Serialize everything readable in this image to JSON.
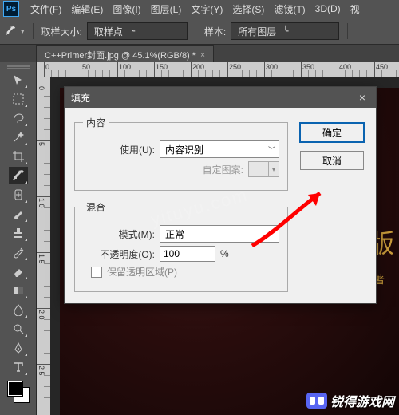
{
  "app_icon_text": "Ps",
  "menubar": [
    "文件(F)",
    "编辑(E)",
    "图像(I)",
    "图层(L)",
    "文字(Y)",
    "选择(S)",
    "滤镜(T)",
    "3D(D)",
    "视"
  ],
  "options_bar": {
    "sample_size_label": "取样大小:",
    "sample_size_value": "取样点",
    "sample_label": "样本:",
    "sample_value": "所有图层"
  },
  "doc_tab": {
    "label": "C++Primer封面.jpg @ 45.1%(RGB/8) *",
    "close": "×"
  },
  "tools": [
    {
      "name": "move-tool-icon"
    },
    {
      "name": "marquee-tool-icon"
    },
    {
      "name": "lasso-tool-icon"
    },
    {
      "name": "magic-wand-tool-icon"
    },
    {
      "name": "crop-tool-icon"
    },
    {
      "name": "eyedropper-tool-icon",
      "selected": true
    },
    {
      "name": "healing-brush-tool-icon"
    },
    {
      "name": "brush-tool-icon"
    },
    {
      "name": "stamp-tool-icon"
    },
    {
      "name": "history-brush-tool-icon"
    },
    {
      "name": "eraser-tool-icon"
    },
    {
      "name": "gradient-tool-icon"
    },
    {
      "name": "blur-tool-icon"
    },
    {
      "name": "dodge-tool-icon"
    },
    {
      "name": "pen-tool-icon"
    },
    {
      "name": "type-tool-icon"
    }
  ],
  "canvas_text": {
    "big": "版",
    "author": "著"
  },
  "dialog": {
    "title": "填充",
    "close": "×",
    "group_content": "内容",
    "use_label": "使用(U):",
    "use_value": "内容识别",
    "custom_pattern_label": "自定图案:",
    "group_blend": "混合",
    "mode_label": "模式(M):",
    "mode_value": "正常",
    "opacity_label": "不透明度(O):",
    "opacity_value": "100",
    "opacity_unit": "%",
    "preserve_transparency_label": "保留透明区域(P)",
    "ok": "确定",
    "cancel": "取消"
  },
  "ruler_h_labels": [
    "0",
    "50",
    "100",
    "150",
    "200",
    "250",
    "300",
    "350",
    "400",
    "450"
  ],
  "ruler_v_labels": [
    "0",
    "5",
    "1 0",
    "1 5",
    "2 0",
    "2 5"
  ],
  "watermark": "yituyu.com",
  "brand": "锐得游戏网"
}
